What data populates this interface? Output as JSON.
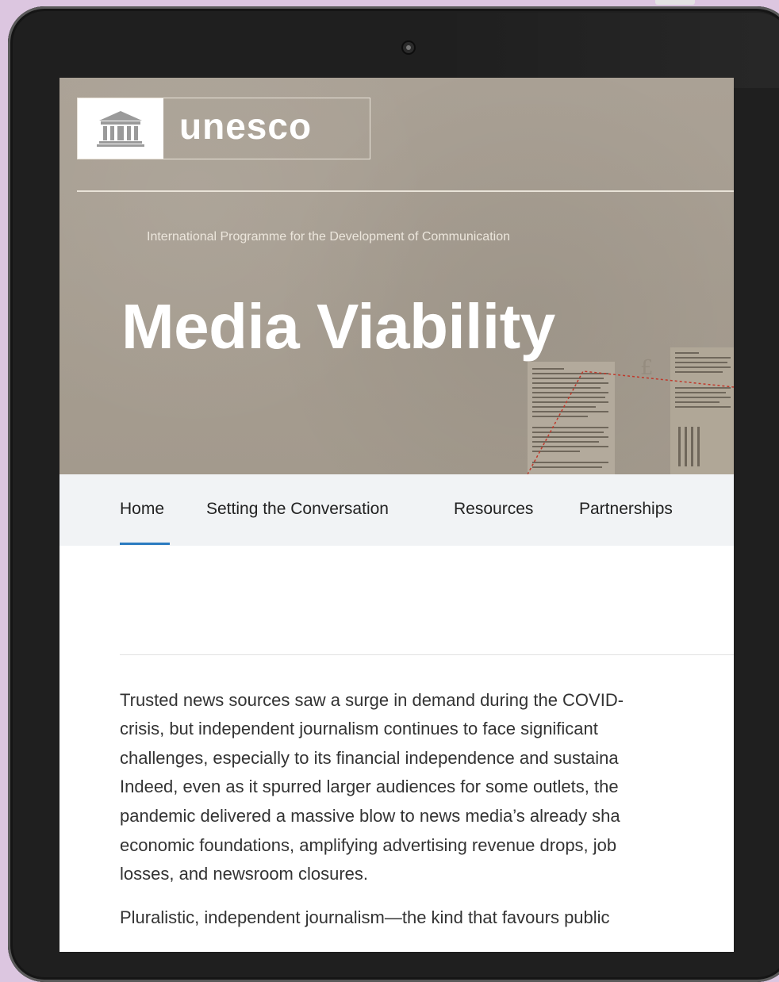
{
  "header": {
    "logo_text": "unesco",
    "program_name": "International Programme for the Development of Communication",
    "page_title": "Media Viability"
  },
  "nav": {
    "items": [
      {
        "label": "Home",
        "active": true
      },
      {
        "label": "Setting the Conversation",
        "active": false
      },
      {
        "label": "Resources",
        "active": false
      },
      {
        "label": "Partnerships",
        "active": false
      }
    ]
  },
  "content": {
    "paragraph1_lines": [
      "Trusted news sources saw a surge in demand during the COVID-",
      "crisis, but independent journalism continues to face significant",
      "challenges, especially to its financial independence and sustaina",
      "Indeed, even as it spurred larger audiences for some outlets, the",
      "pandemic delivered a massive blow to news media’s already sha",
      "economic foundations, amplifying advertising revenue drops, job",
      "losses, and newsroom closures."
    ],
    "paragraph2_line": "Pluralistic, independent journalism—the kind that favours public"
  },
  "colors": {
    "hero_background": "#a89f92",
    "nav_background": "#f1f3f5",
    "active_underline": "#2b7bc0",
    "page_background": "#dcc6e0",
    "device_frame": "#1f1f1f"
  },
  "icons": {
    "logo_emblem": "temple-icon",
    "camera": "camera-icon"
  }
}
